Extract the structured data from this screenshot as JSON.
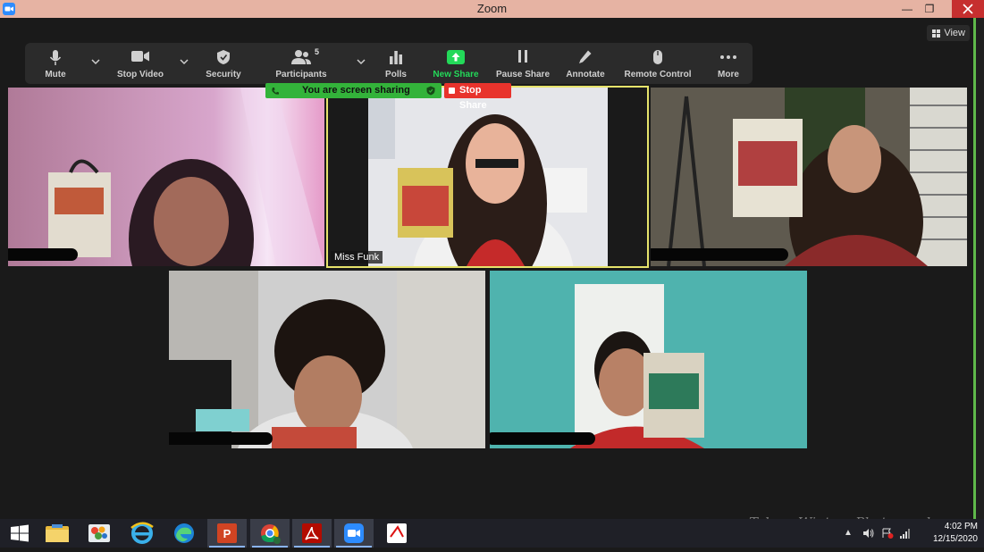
{
  "window": {
    "title": "Zoom",
    "controls": [
      "minimize",
      "restore",
      "close"
    ]
  },
  "view_button": {
    "label": "View"
  },
  "toolbar": {
    "mute": "Mute",
    "stop_video": "Stop Video",
    "security": "Security",
    "participants": "Participants",
    "participants_count": "5",
    "polls": "Polls",
    "new_share": "New Share",
    "pause_share": "Pause Share",
    "annotate": "Annotate",
    "remote_control": "Remote Control",
    "more": "More"
  },
  "share_banner": {
    "status_text": "You are screen sharing",
    "stop_label": "Stop Share"
  },
  "participants_tiles": [
    {
      "name": ""
    },
    {
      "name": "Miss Funk",
      "active_speaker": true
    },
    {
      "name": ""
    },
    {
      "name": ""
    },
    {
      "name": ""
    }
  ],
  "taskbar": {
    "apps": [
      "windows-start",
      "file-explorer",
      "paint",
      "internet-explorer",
      "edge",
      "powerpoint",
      "chrome",
      "acrobat",
      "zoom",
      "generic-app"
    ],
    "time": "4:02 PM",
    "date": "12/15/2020"
  },
  "watermark": "Talena Winters Photography",
  "colors": {
    "share_green": "#33b33a",
    "stop_red": "#e8332c",
    "active_border": "#e6e36b",
    "new_share_green": "#23d959"
  }
}
